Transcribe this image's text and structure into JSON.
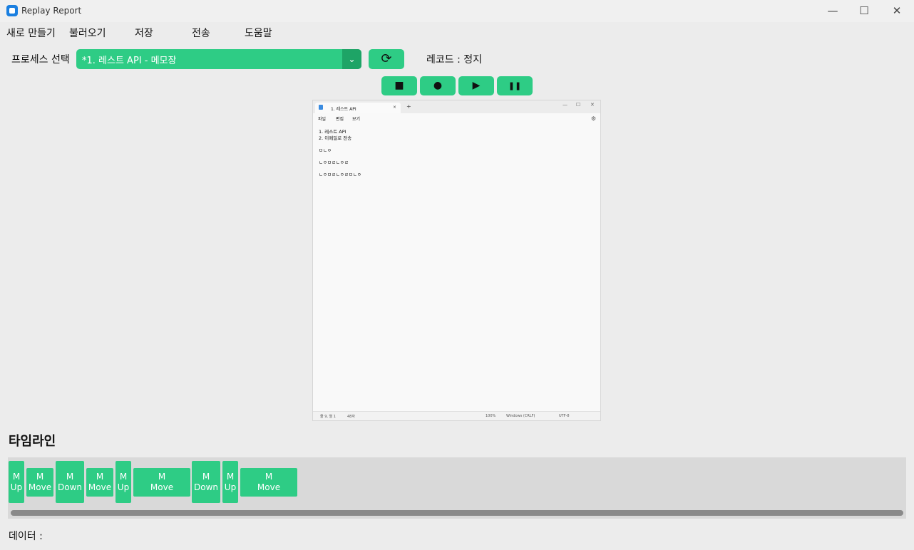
{
  "window": {
    "title": "Replay Report",
    "minimize": "—",
    "maximize": "☐",
    "close": "✕"
  },
  "menu": [
    "새로 만들기",
    "불러오기",
    "저장",
    "전송",
    "도움말"
  ],
  "process": {
    "label": "프로세스 선택",
    "selected": "*1. 레스트 API - 메모장",
    "dropdown_icon": "⌄",
    "refresh_icon": "⟳"
  },
  "record": {
    "label": "레코드 : 정지"
  },
  "controls": [
    {
      "name": "stop-button",
      "icon": "■"
    },
    {
      "name": "record-button",
      "icon": "●"
    },
    {
      "name": "play-button",
      "icon": "▶"
    },
    {
      "name": "pause-button",
      "icon": "❚❚"
    }
  ],
  "preview": {
    "tab_title": "1. 레스트 API",
    "tab_close": "×",
    "new_tab": "+",
    "menu": [
      "파일",
      "편집",
      "보기"
    ],
    "lines": [
      "1. 레스트 API",
      "2. 이메일로 전송",
      "",
      "ㅁㄴㅇ",
      "",
      "ㄴㅇㅁㄹㄴㅇㄹ",
      "",
      "ㄴㅇㅁㄹㄴㅇㄹㅁㄴㅇ"
    ],
    "status": {
      "position": "줄 9, 열 1",
      "chars": "48자",
      "zoom": "100%",
      "eol": "Windows (CRLF)",
      "encoding": "UTF-8"
    }
  },
  "timeline": {
    "title": "타임라인",
    "events": [
      {
        "line1": "M",
        "line2": "Up"
      },
      {
        "line1": "M",
        "line2": "Move"
      },
      {
        "line1": "M",
        "line2": "Down"
      },
      {
        "line1": "M",
        "line2": "Move"
      },
      {
        "line1": "M",
        "line2": "Up"
      },
      {
        "line1": "M",
        "line2": "Move"
      },
      {
        "line1": "M",
        "line2": "Down"
      },
      {
        "line1": "M",
        "line2": "Up"
      },
      {
        "line1": "M",
        "line2": "Move"
      }
    ]
  },
  "data": {
    "label": "데이터 :"
  },
  "colors": {
    "accent": "#2ecc85",
    "accent_dark": "#1ea466",
    "background": "#ececec"
  }
}
